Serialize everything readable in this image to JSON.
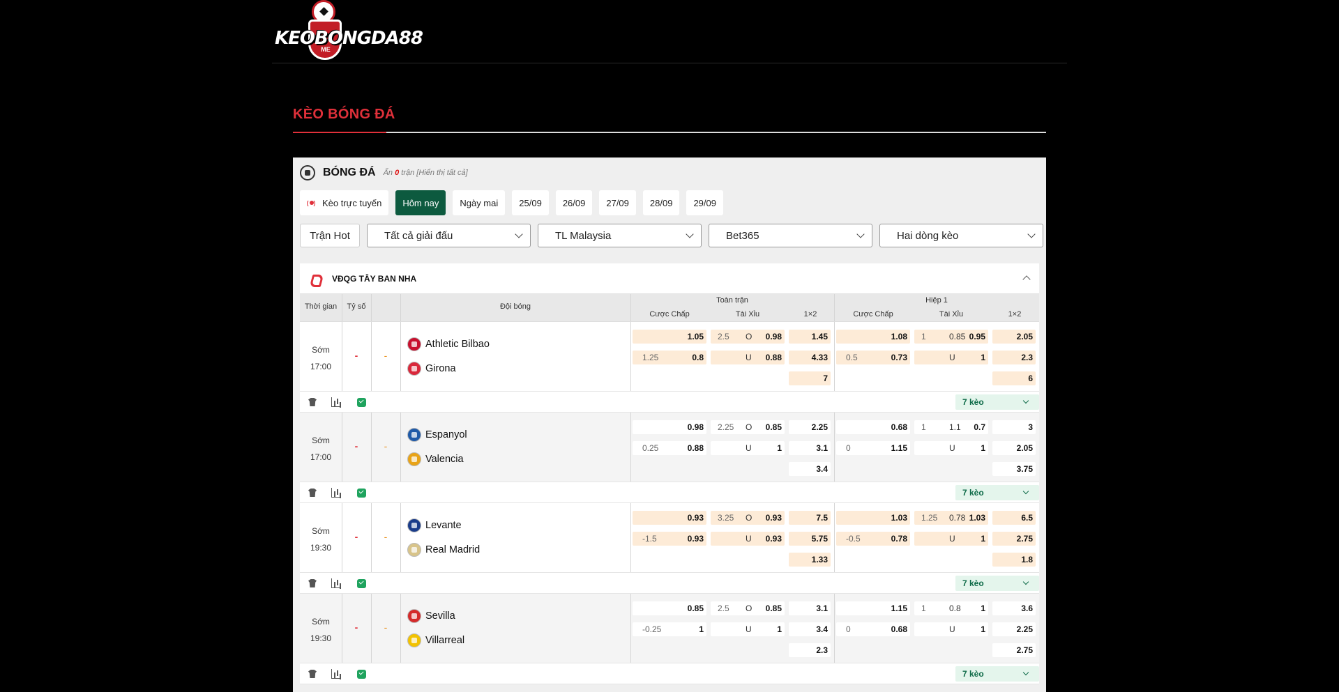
{
  "brand": {
    "logo_text": "KEOBONGDA88",
    "logo_sub": "ME"
  },
  "page": {
    "title": "KÈO BÓNG ĐÁ"
  },
  "sport": {
    "title": "BÓNG ĐÁ",
    "hidden_prefix": "Ẩn",
    "hidden_count": "0",
    "hidden_suffix": "trận [Hiển thị tất cả]"
  },
  "date_tabs": [
    "Kèo trực tuyến",
    "Hôm nay",
    "Ngày mai",
    "25/09",
    "26/09",
    "27/09",
    "28/09",
    "29/09"
  ],
  "active_tab": "Hôm nay",
  "filters": {
    "hot_label": "Trận Hot",
    "league_select": "Tất cả giải đấu",
    "odds_type_select": "TL Malaysia",
    "bookmaker_select": "Bet365",
    "lines_select": "Hai dòng kèo"
  },
  "league": {
    "name": "VĐQG TÂY BAN NHA"
  },
  "table_headers": {
    "time": "Thời gian",
    "score": "Tỷ số",
    "teams": "Đội bóng",
    "full_match": "Toàn trận",
    "first_half": "Hiệp 1",
    "handicap": "Cược Chấp",
    "over_under": "Tài Xỉu",
    "one_x_two": "1×2"
  },
  "matches": [
    {
      "status": "Sớm",
      "time": "17:00",
      "score": "-",
      "half_score": "-",
      "home": "Athletic Bilbao",
      "away": "Girona",
      "highlight": true,
      "ft": {
        "hdp": [
          [
            "",
            "1.05"
          ],
          [
            "1.25",
            "0.8"
          ]
        ],
        "ou": [
          [
            "2.5",
            "O",
            "0.98"
          ],
          [
            "",
            "U",
            "0.88"
          ]
        ],
        "x12": [
          "1.45",
          "4.33",
          "7"
        ]
      },
      "h1": {
        "hdp": [
          [
            "",
            "1.08"
          ],
          [
            "0.5",
            "0.73"
          ]
        ],
        "ou": [
          [
            "1",
            "0.85",
            "0.95"
          ],
          [
            "",
            "U",
            "1"
          ]
        ],
        "x12": [
          "2.05",
          "2.3",
          "6"
        ]
      },
      "more_label": "7 kèo"
    },
    {
      "status": "Sớm",
      "time": "17:00",
      "score": "-",
      "half_score": "-",
      "home": "Espanyol",
      "away": "Valencia",
      "highlight": false,
      "ft": {
        "hdp": [
          [
            "",
            "0.98"
          ],
          [
            "0.25",
            "0.88"
          ]
        ],
        "ou": [
          [
            "2.25",
            "O",
            "0.85"
          ],
          [
            "",
            "U",
            "1"
          ]
        ],
        "x12": [
          "2.25",
          "3.1",
          "3.4"
        ]
      },
      "h1": {
        "hdp": [
          [
            "",
            "0.68"
          ],
          [
            "0",
            "1.15"
          ]
        ],
        "ou": [
          [
            "1",
            "1.1",
            "0.7"
          ],
          [
            "",
            "U",
            "1"
          ]
        ],
        "x12": [
          "3",
          "2.05",
          "3.75"
        ]
      },
      "more_label": "7 kèo"
    },
    {
      "status": "Sớm",
      "time": "19:30",
      "score": "-",
      "half_score": "-",
      "home": "Levante",
      "away": "Real Madrid",
      "highlight": true,
      "ft": {
        "hdp": [
          [
            "",
            "0.93"
          ],
          [
            "-1.5",
            "0.93"
          ]
        ],
        "ou": [
          [
            "3.25",
            "O",
            "0.93"
          ],
          [
            "",
            "U",
            "0.93"
          ]
        ],
        "x12": [
          "7.5",
          "5.75",
          "1.33"
        ]
      },
      "h1": {
        "hdp": [
          [
            "",
            "1.03"
          ],
          [
            "-0.5",
            "0.78"
          ]
        ],
        "ou": [
          [
            "1.25",
            "0.78",
            "1.03"
          ],
          [
            "",
            "U",
            "1"
          ]
        ],
        "x12": [
          "6.5",
          "2.75",
          "1.8"
        ]
      },
      "more_label": "7 kèo"
    },
    {
      "status": "Sớm",
      "time": "19:30",
      "score": "-",
      "half_score": "-",
      "home": "Sevilla",
      "away": "Villarreal",
      "highlight": false,
      "ft": {
        "hdp": [
          [
            "",
            "0.85"
          ],
          [
            "-0.25",
            "1"
          ]
        ],
        "ou": [
          [
            "2.5",
            "O",
            "0.85"
          ],
          [
            "",
            "U",
            "1"
          ]
        ],
        "x12": [
          "3.1",
          "3.4",
          "2.3"
        ]
      },
      "h1": {
        "hdp": [
          [
            "",
            "1.15"
          ],
          [
            "0",
            "0.68"
          ]
        ],
        "ou": [
          [
            "1",
            "0.8",
            "1"
          ],
          [
            "",
            "U",
            "1"
          ]
        ],
        "x12": [
          "3.6",
          "2.25",
          "2.75"
        ]
      },
      "more_label": "7 kèo"
    }
  ],
  "icons": {
    "sport": "soccer-ball-icon",
    "live": "broadcast-icon",
    "league": "laliga-icon",
    "shirt": "shirt-icon",
    "stats": "stats-icon",
    "check": "check-icon"
  },
  "team_colors": {
    "Athletic Bilbao": "#c8102e",
    "Girona": "#d9283b",
    "Espanyol": "#1f5aa8",
    "Valencia": "#e8a317",
    "Levante": "#1a3c8a",
    "Real Madrid": "#d8c48a",
    "Sevilla": "#d42a2a",
    "Villarreal": "#f2c200"
  },
  "colors": {
    "accent_red": "#e0303a",
    "active_green": "#0d5a3f",
    "odds_highlight": "#fdebd7",
    "more_badge": "#e4f5ec"
  }
}
